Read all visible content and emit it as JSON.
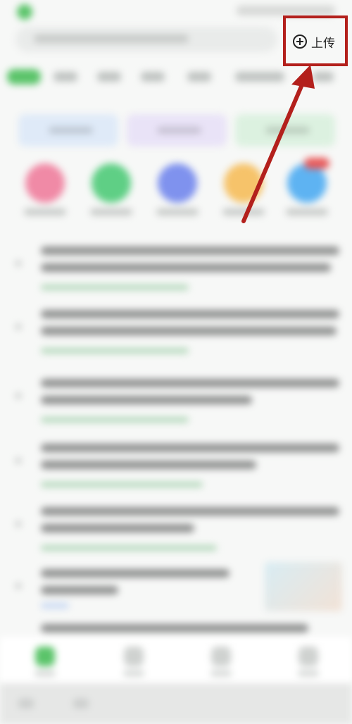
{
  "header": {
    "upload_label": "上传"
  },
  "colors": {
    "accent_green": "#5bc46a",
    "annotation_red": "#b3201c"
  },
  "icons": {
    "upload": "plus-circle-icon"
  },
  "annotation": {
    "type": "arrow-and-box",
    "target": "upload-button"
  }
}
